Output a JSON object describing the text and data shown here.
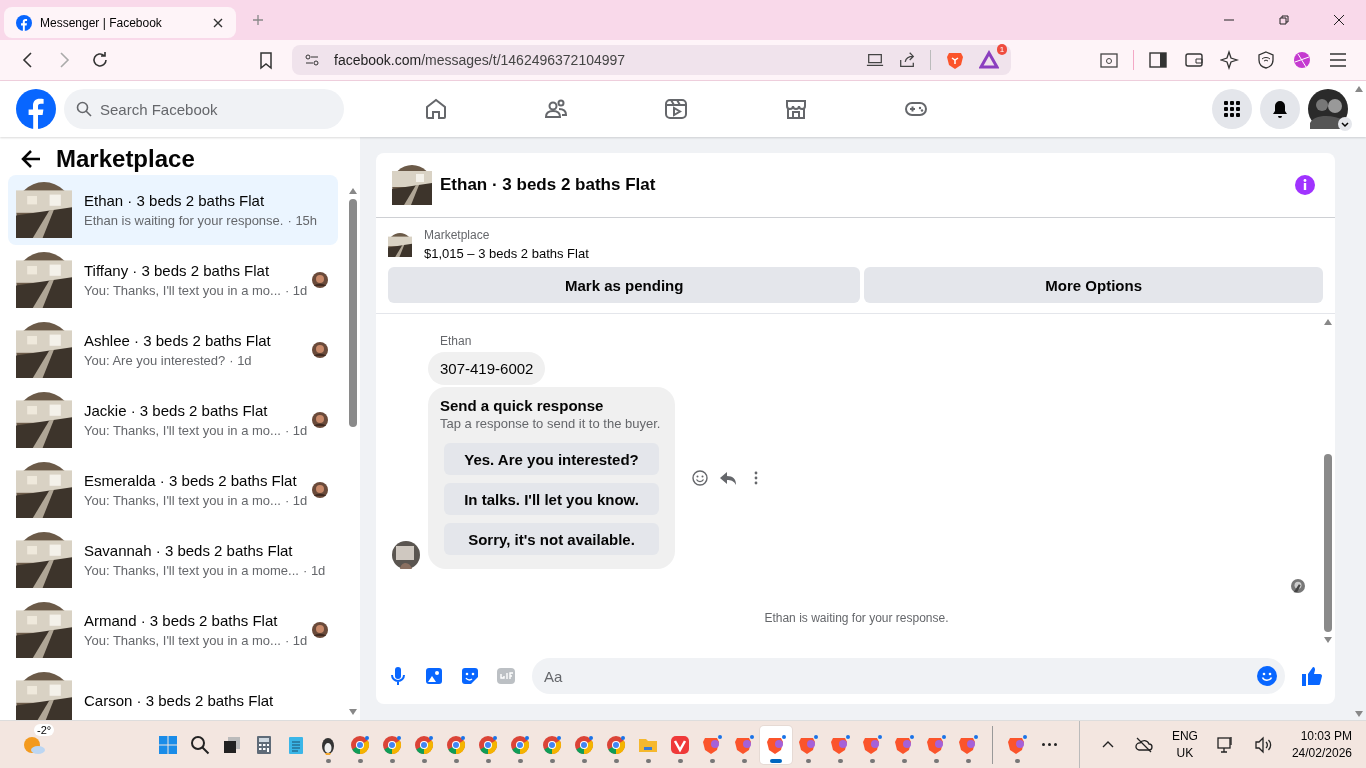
{
  "browser": {
    "tab_title": "Messenger | Facebook",
    "url_host": "facebook.com",
    "url_path": "/messages/t/1462496372104997",
    "rewards_badge": "1"
  },
  "header": {
    "search": {
      "placeholder": "Search Facebook"
    }
  },
  "sidebar": {
    "title": "Marketplace",
    "conversations": [
      {
        "name": "Ethan · 3 beds 2 baths Flat",
        "preview": "Ethan is waiting for your response.",
        "time": "· 15h",
        "selected": true,
        "seen": false
      },
      {
        "name": "Tiffany · 3 beds 2 baths Flat",
        "preview": "You: Thanks, I'll text you in a mo...",
        "time": "· 1d",
        "selected": false,
        "seen": true
      },
      {
        "name": "Ashlee · 3 beds 2 baths Flat",
        "preview": "You: Are you interested?",
        "time": "· 1d",
        "selected": false,
        "seen": true
      },
      {
        "name": "Jackie · 3 beds 2 baths Flat",
        "preview": "You: Thanks, I'll text you in a mo...",
        "time": "· 1d",
        "selected": false,
        "seen": true
      },
      {
        "name": "Esmeralda · 3 beds 2 baths Flat",
        "preview": "You: Thanks, I'll text you in a mo...",
        "time": "· 1d",
        "selected": false,
        "seen": true
      },
      {
        "name": "Savannah · 3 beds 2 baths Flat",
        "preview": "You: Thanks, I'll text you in a mome...",
        "time": "· 1d",
        "selected": false,
        "seen": false
      },
      {
        "name": "Armand · 3 beds 2 baths Flat",
        "preview": "You: Thanks, I'll text you in a mo...",
        "time": "· 1d",
        "selected": false,
        "seen": true
      },
      {
        "name": "Carson · 3 beds 2 baths Flat",
        "selected": false
      }
    ]
  },
  "chat": {
    "title": "Ethan · 3 beds 2 baths Flat",
    "listing": {
      "label": "Marketplace",
      "title": "$1,015 – 3 beds 2 baths Flat"
    },
    "actions": [
      "Mark as pending",
      "More Options"
    ],
    "sender": "Ethan",
    "message": "307-419-6002",
    "quick_response": {
      "title": "Send a quick response",
      "subtitle": "Tap a response to send it to the buyer.",
      "options": [
        "Yes. Are you interested?",
        "In talks. I'll let you know.",
        "Sorry, it's not available."
      ]
    },
    "status": "Ethan is waiting for your response.",
    "composer": {
      "placeholder": "Aa"
    }
  },
  "taskbar": {
    "weather": "-2°",
    "apps": [
      {
        "kind": "start",
        "selected": false,
        "running": false
      },
      {
        "kind": "search",
        "selected": false,
        "running": false
      },
      {
        "kind": "taskview",
        "selected": false,
        "running": false
      },
      {
        "kind": "calculator",
        "selected": false,
        "running": false
      },
      {
        "kind": "notepad",
        "selected": false,
        "running": false
      },
      {
        "kind": "penguin",
        "selected": false,
        "running": true
      },
      {
        "kind": "chrome",
        "selected": false,
        "running": true
      },
      {
        "kind": "chrome",
        "selected": false,
        "running": true
      },
      {
        "kind": "chrome",
        "selected": false,
        "running": true
      },
      {
        "kind": "chrome",
        "selected": false,
        "running": true
      },
      {
        "kind": "chrome",
        "selected": false,
        "running": true
      },
      {
        "kind": "chrome",
        "selected": false,
        "running": true
      },
      {
        "kind": "chrome",
        "selected": false,
        "running": true
      },
      {
        "kind": "chrome",
        "selected": false,
        "running": true
      },
      {
        "kind": "chrome",
        "selected": false,
        "running": true
      },
      {
        "kind": "folder",
        "selected": false,
        "running": true
      },
      {
        "kind": "vivaldi",
        "selected": false,
        "running": true
      },
      {
        "kind": "brave",
        "selected": false,
        "running": true
      },
      {
        "kind": "brave",
        "selected": false,
        "running": true
      },
      {
        "kind": "brave",
        "selected": true,
        "running": true
      },
      {
        "kind": "brave",
        "selected": false,
        "running": true
      },
      {
        "kind": "brave",
        "selected": false,
        "running": true
      },
      {
        "kind": "brave",
        "selected": false,
        "running": true
      },
      {
        "kind": "brave",
        "selected": false,
        "running": true
      },
      {
        "kind": "brave",
        "selected": false,
        "running": true
      },
      {
        "kind": "brave",
        "selected": false,
        "running": true
      },
      {
        "kind": "separator"
      },
      {
        "kind": "brave",
        "selected": false,
        "running": true
      },
      {
        "kind": "more",
        "selected": false,
        "running": false
      }
    ],
    "language": "ENG",
    "region": "UK",
    "time": "10:03 PM",
    "date": "24/02/2026"
  }
}
